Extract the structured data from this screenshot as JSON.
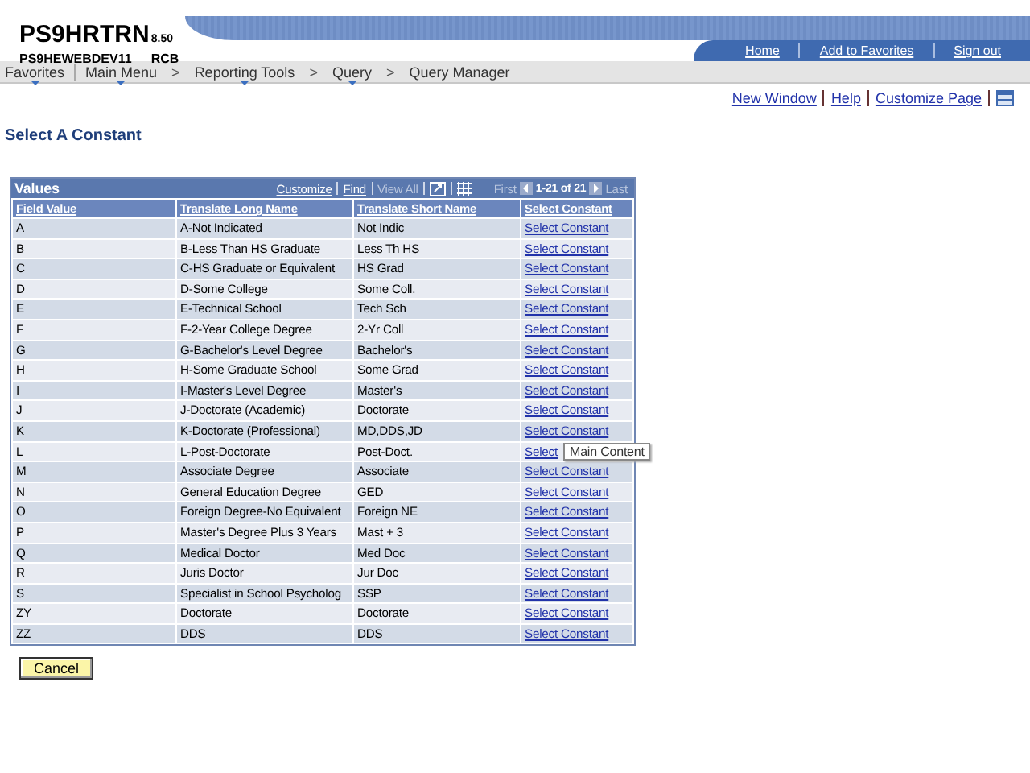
{
  "header": {
    "database": "PS9HRTRN",
    "version": "8.50",
    "server": "PS9HEWEBDEV11",
    "user": "RCB",
    "links": [
      "Home",
      "Add to Favorites",
      "Sign out"
    ]
  },
  "nav": [
    {
      "label": "Favorites",
      "menu": true
    },
    {
      "label": "Main Menu",
      "menu": true,
      "separator": ">"
    },
    {
      "label": "Reporting Tools",
      "menu": true,
      "separator": ">"
    },
    {
      "label": "Query",
      "menu": true,
      "separator": ">"
    },
    {
      "label": "Query Manager",
      "menu": false
    }
  ],
  "page_links": [
    "New Window",
    "Help",
    "Customize Page"
  ],
  "title": "Select A Constant",
  "grid": {
    "caption": "Values",
    "tools": [
      {
        "label": "Customize",
        "disabled": false
      },
      {
        "label": "Find",
        "disabled": false
      },
      {
        "label": "View All",
        "disabled": true
      }
    ],
    "first": "First",
    "range": "1-21 of 21",
    "last": "Last",
    "columns": [
      "Field Value",
      "Translate Long Name",
      "Translate Short Name",
      "Select Constant"
    ],
    "rows": [
      {
        "value": "A",
        "long": "A-Not Indicated",
        "short": "Not Indic",
        "link": "Select Constant"
      },
      {
        "value": "B",
        "long": "B-Less Than HS Graduate",
        "short": "Less Th HS",
        "link": "Select Constant"
      },
      {
        "value": "C",
        "long": "C-HS Graduate or Equivalent",
        "short": "HS Grad",
        "link": "Select Constant"
      },
      {
        "value": "D",
        "long": "D-Some College",
        "short": "Some Coll.",
        "link": "Select Constant"
      },
      {
        "value": "E",
        "long": "E-Technical School",
        "short": "Tech Sch",
        "link": "Select Constant"
      },
      {
        "value": "F",
        "long": "F-2-Year College Degree",
        "short": "2-Yr Coll",
        "link": "Select Constant"
      },
      {
        "value": "G",
        "long": "G-Bachelor's Level Degree",
        "short": "Bachelor's",
        "link": "Select Constant"
      },
      {
        "value": "H",
        "long": "H-Some Graduate School",
        "short": "Some Grad",
        "link": "Select Constant"
      },
      {
        "value": "I",
        "long": "I-Master's Level Degree",
        "short": "Master's",
        "link": "Select Constant"
      },
      {
        "value": "J",
        "long": "J-Doctorate (Academic)",
        "short": "Doctorate",
        "link": "Select Constant"
      },
      {
        "value": "K",
        "long": "K-Doctorate (Professional)",
        "short": "MD,DDS,JD",
        "link": "Select Constant"
      },
      {
        "value": "L",
        "long": "L-Post-Doctorate",
        "short": "Post-Doct.",
        "link": "Select",
        "tooltip": "Main Content"
      },
      {
        "value": "M",
        "long": "Associate Degree",
        "short": "Associate",
        "link": "Select Constant"
      },
      {
        "value": "N",
        "long": "General Education Degree",
        "short": "GED",
        "link": "Select Constant"
      },
      {
        "value": "O",
        "long": "Foreign Degree-No Equivalent",
        "short": "Foreign NE",
        "link": "Select Constant"
      },
      {
        "value": "P",
        "long": "Master's Degree Plus 3 Years",
        "short": "Mast + 3",
        "link": "Select Constant"
      },
      {
        "value": "Q",
        "long": "Medical Doctor",
        "short": "Med Doc",
        "link": "Select Constant"
      },
      {
        "value": "R",
        "long": "Juris Doctor",
        "short": "Jur Doc",
        "link": "Select Constant"
      },
      {
        "value": "S",
        "long": "Specialist in School Psycholog",
        "short": "SSP",
        "link": "Select Constant"
      },
      {
        "value": "ZY",
        "long": "Doctorate",
        "short": "Doctorate",
        "link": "Select Constant"
      },
      {
        "value": "ZZ",
        "long": "DDS",
        "short": "DDS",
        "link": "Select Constant"
      }
    ]
  },
  "buttons": [
    "Cancel"
  ]
}
